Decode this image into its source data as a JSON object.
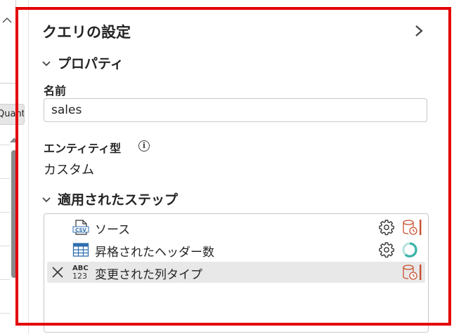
{
  "left_strip": {
    "column_chip": "Quant"
  },
  "panel": {
    "title": "クエリの設定",
    "properties": {
      "heading": "プロパティ",
      "name_label": "名前",
      "name_value": "sales",
      "entity_type_label": "エンティティ型",
      "entity_type_value": "カスタム"
    },
    "applied_steps": {
      "heading": "適用されたステップ",
      "steps": [
        {
          "label": "ソース",
          "icon": "csv-file-icon",
          "has_settings": true,
          "status": "database-clock-icon",
          "selected": false
        },
        {
          "label": "昇格されたヘッダー数",
          "icon": "table-icon",
          "has_settings": true,
          "status": "loading-spinner-icon",
          "selected": false
        },
        {
          "label": "変更された列タイプ",
          "icon": "abc123-type-icon",
          "icon_text_top": "ABC",
          "icon_text_bottom": "123",
          "has_settings": false,
          "status": "database-clock-icon",
          "selected": true
        }
      ]
    }
  },
  "colors": {
    "highlight": "#e30000",
    "warning_orange": "#c8502e",
    "spinner_teal": "#3bb3a8",
    "table_blue": "#2f6fb0",
    "selected_row": "#e8e8e8"
  }
}
